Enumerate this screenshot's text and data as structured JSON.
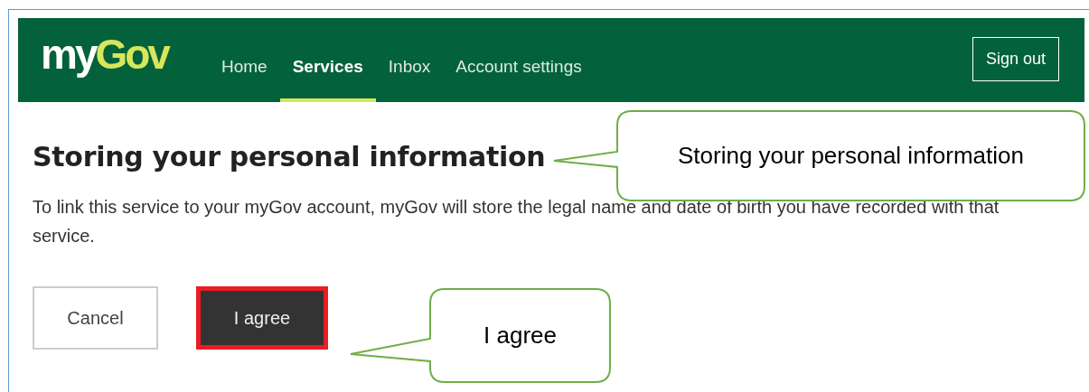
{
  "header": {
    "logo": {
      "part_1": "my",
      "part_2": "Gov"
    },
    "nav": [
      {
        "label": "Home",
        "selected": false
      },
      {
        "label": "Services",
        "selected": true
      },
      {
        "label": "Inbox",
        "selected": false
      },
      {
        "label": "Account settings",
        "selected": false
      }
    ],
    "sign_out": "Sign out"
  },
  "content": {
    "heading": "Storing your personal information",
    "paragraph": "To link this service to your myGov account, myGov will store the legal name and date of birth you have recorded with that service.",
    "buttons": [
      {
        "label": "Cancel",
        "kind": "secondary",
        "highlighted": false
      },
      {
        "label": "I agree",
        "kind": "primary",
        "highlighted": true
      }
    ]
  },
  "callouts": [
    {
      "text": "Storing your personal information"
    },
    {
      "text": "I agree"
    }
  ]
}
